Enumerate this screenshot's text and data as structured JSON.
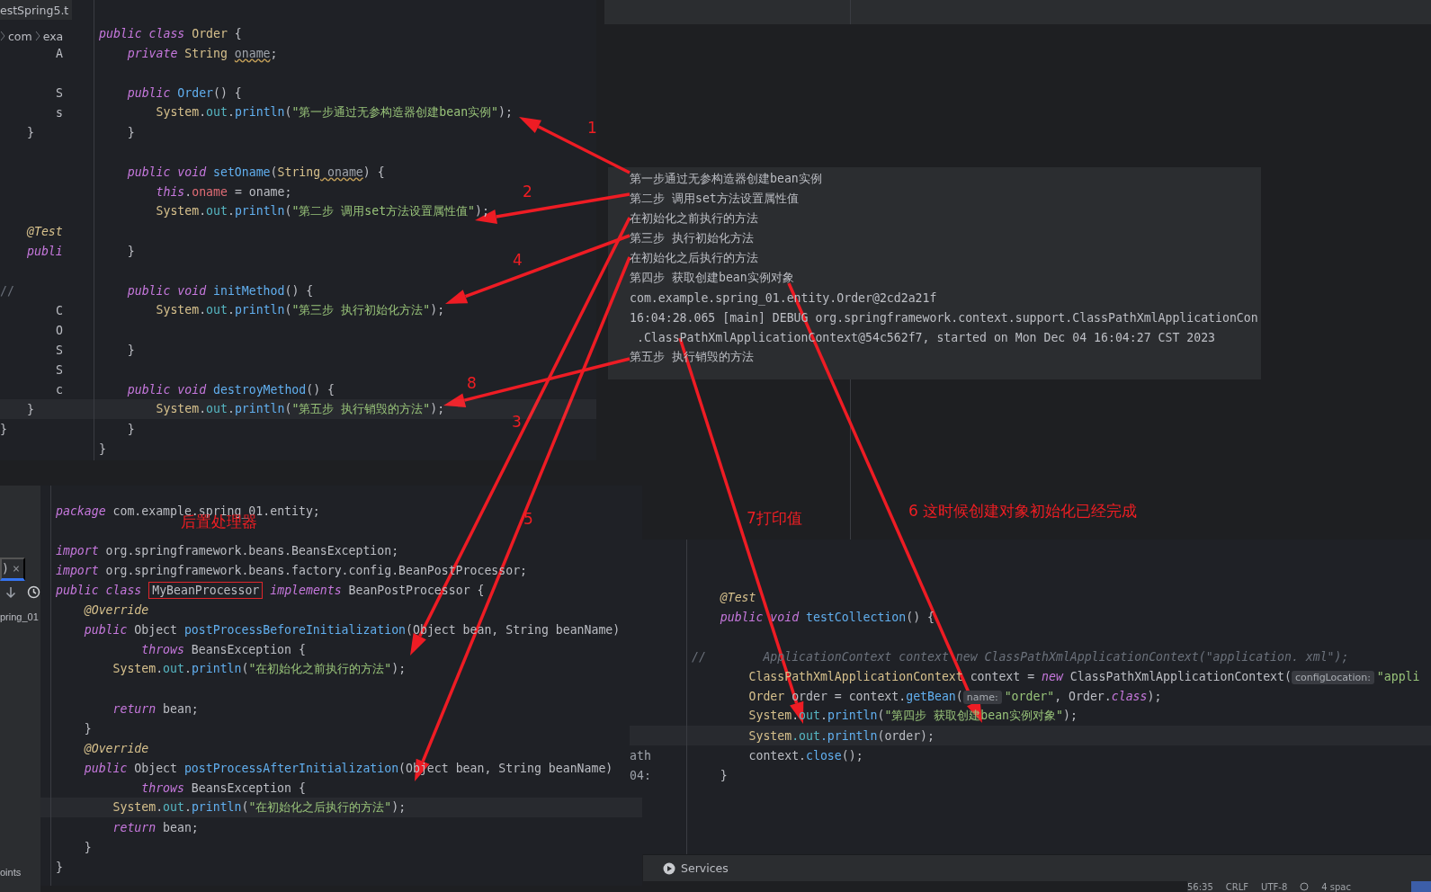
{
  "top_editor": {
    "tab": "estSpring5.t",
    "breadcrumbs": [
      "com",
      "exa"
    ],
    "rows": [
      {
        "kind": "top",
        "tokens": [
          {
            "kind": "kw",
            "text": "public class"
          },
          {
            "kind": "type",
            "text": " Order"
          },
          {
            "kind": "plain",
            "text": " {"
          }
        ]
      },
      {
        "kind": "member",
        "side": {
          "text": "A",
          "kind": "member"
        },
        "tokens": [
          {
            "kind": "kw",
            "text": "private"
          },
          {
            "kind": "type",
            "text": " String "
          },
          {
            "kind": "warn",
            "text": "oname"
          },
          {
            "kind": "plain",
            "text": ";"
          }
        ]
      },
      {
        "kind": "blank"
      },
      {
        "kind": "member",
        "side": {
          "text": "S",
          "kind": "member"
        },
        "tokens": [
          {
            "kind": "kw",
            "text": "public"
          },
          {
            "kind": "fn",
            "text": " Order"
          },
          {
            "kind": "plain",
            "text": "() {"
          }
        ]
      },
      {
        "kind": "statement",
        "side": {
          "text": "s",
          "kind": "member"
        },
        "tokens": [
          {
            "kind": "type",
            "text": "System"
          },
          {
            "kind": "plain",
            "text": "."
          },
          {
            "kind": "field",
            "text": "out"
          },
          {
            "kind": "plain",
            "text": "."
          },
          {
            "kind": "fn",
            "text": "println"
          },
          {
            "kind": "plain",
            "text": "("
          },
          {
            "kind": "str",
            "text": "\"第一步通过无参构造器创建bean实例\""
          },
          {
            "kind": "plain",
            "text": ");"
          }
        ]
      },
      {
        "kind": "member",
        "side": {
          "text": "}",
          "kind": "close-method"
        },
        "tokens": [
          {
            "kind": "plain",
            "text": "}"
          }
        ]
      },
      {
        "kind": "blank"
      },
      {
        "kind": "member",
        "tokens": [
          {
            "kind": "kw",
            "text": "public void"
          },
          {
            "kind": "fn",
            "text": " setOname"
          },
          {
            "kind": "plain",
            "text": "("
          },
          {
            "kind": "type",
            "text": "String"
          },
          {
            "kind": "warn",
            "text": " oname"
          },
          {
            "kind": "plain",
            "text": ") {"
          }
        ]
      },
      {
        "kind": "statement",
        "tokens": [
          {
            "kind": "kw",
            "text": "this"
          },
          {
            "kind": "plain",
            "text": "."
          },
          {
            "kind": "var",
            "text": "oname"
          },
          {
            "kind": "plain",
            "text": " = oname;"
          }
        ]
      },
      {
        "kind": "statement",
        "tokens": [
          {
            "kind": "type",
            "text": "System"
          },
          {
            "kind": "plain",
            "text": "."
          },
          {
            "kind": "field",
            "text": "out"
          },
          {
            "kind": "plain",
            "text": "."
          },
          {
            "kind": "fn",
            "text": "println"
          },
          {
            "kind": "plain",
            "text": "("
          },
          {
            "kind": "str",
            "text": "\"第二步 调用set方法设置属性值\""
          },
          {
            "kind": "plain",
            "text": ");"
          }
        ]
      },
      {
        "kind": "top",
        "side": {
          "text": "@Test",
          "kind": "annotation"
        }
      },
      {
        "kind": "member",
        "side": {
          "text": "publi",
          "kind": "keyword"
        },
        "tokens": [
          {
            "kind": "plain",
            "text": "}"
          }
        ]
      },
      {
        "kind": "blank"
      },
      {
        "kind": "member",
        "side": {
          "text": "//",
          "kind": "comment"
        },
        "tokens": [
          {
            "kind": "kw",
            "text": "public void"
          },
          {
            "kind": "fn",
            "text": " initMethod"
          },
          {
            "kind": "plain",
            "text": "() {"
          }
        ]
      },
      {
        "kind": "statement",
        "side": {
          "text": "C",
          "kind": "member"
        },
        "tokens": [
          {
            "kind": "type",
            "text": "System"
          },
          {
            "kind": "plain",
            "text": "."
          },
          {
            "kind": "field",
            "text": "out"
          },
          {
            "kind": "plain",
            "text": "."
          },
          {
            "kind": "fn",
            "text": "println"
          },
          {
            "kind": "plain",
            "text": "("
          },
          {
            "kind": "str",
            "text": "\"第三步 执行初始化方法\""
          },
          {
            "kind": "plain",
            "text": ");"
          }
        ]
      },
      {
        "kind": "top",
        "side": {
          "text": "O",
          "kind": "member"
        }
      },
      {
        "kind": "member",
        "side": {
          "text": "S",
          "kind": "member"
        },
        "tokens": [
          {
            "kind": "plain",
            "text": "}"
          }
        ]
      },
      {
        "kind": "top",
        "side": {
          "text": "S",
          "kind": "member"
        }
      },
      {
        "kind": "member",
        "side": {
          "text": "c",
          "kind": "member"
        },
        "tokens": [
          {
            "kind": "kw",
            "text": "public void"
          },
          {
            "kind": "fn",
            "text": " destroyMethod"
          },
          {
            "kind": "plain",
            "text": "() {"
          }
        ]
      },
      {
        "kind": "statement",
        "current": true,
        "side": {
          "text": "}",
          "kind": "close-method"
        },
        "tokens": [
          {
            "kind": "type",
            "text": "System"
          },
          {
            "kind": "plain",
            "text": "."
          },
          {
            "kind": "field",
            "text": "out"
          },
          {
            "kind": "plain",
            "text": "."
          },
          {
            "kind": "fn",
            "text": "println"
          },
          {
            "kind": "plain",
            "text": "("
          },
          {
            "kind": "str",
            "text": "\"第五步 执行销毁的方法\""
          },
          {
            "kind": "plain",
            "text": ");"
          }
        ]
      },
      {
        "kind": "member",
        "side": {
          "text": "}",
          "kind": "close-class"
        },
        "tokens": [
          {
            "kind": "plain",
            "text": "}"
          }
        ]
      },
      {
        "kind": "top",
        "tokens": [
          {
            "kind": "plain",
            "text": "}"
          }
        ]
      }
    ]
  },
  "console": {
    "lines": [
      {
        "kind": "top",
        "text": "第一步通过无参构造器创建bean实例"
      },
      {
        "kind": "top",
        "text": "第二步 调用set方法设置属性值"
      },
      {
        "kind": "top",
        "text": "在初始化之前执行的方法"
      },
      {
        "kind": "top",
        "text": "第三步 执行初始化方法"
      },
      {
        "kind": "top",
        "text": "在初始化之后执行的方法"
      },
      {
        "kind": "top",
        "text": "第四步 获取创建bean实例对象"
      },
      {
        "kind": "top",
        "text": "com.example.spring_01.entity.Order@2cd2a21f"
      },
      {
        "kind": "top",
        "text": "16:04:28.065 [main] DEBUG org.springframework.context.support.ClassPathXmlApplicationCon"
      },
      {
        "kind": "wrapped",
        "text": ".ClassPathXmlApplicationContext@54c562f7, started on Mon Dec 04 16:04:27 CST 2023"
      },
      {
        "kind": "top",
        "text": "第五步 执行销毁的方法"
      }
    ]
  },
  "processor_editor": {
    "left_panel": {
      "tab": {
        "label": ")",
        "close": "×",
        "selected": true
      },
      "project_item": "pring_01",
      "bottom_item": "oints"
    },
    "rows": [
      {
        "kind": "top",
        "tokens": [
          {
            "kind": "kw",
            "text": "package"
          },
          {
            "kind": "plain",
            "text": " com.example.spring_01.entity;"
          }
        ]
      },
      {
        "kind": "blank"
      },
      {
        "kind": "top",
        "tokens": [
          {
            "kind": "kw",
            "text": "import"
          },
          {
            "kind": "plain",
            "text": " org.springframework.beans.BeansException;"
          }
        ]
      },
      {
        "kind": "top",
        "tokens": [
          {
            "kind": "kw",
            "text": "import"
          },
          {
            "kind": "plain",
            "text": " org.springframework.beans.factory.config.BeanPostProcessor;"
          }
        ]
      },
      {
        "kind": "top",
        "tokens": [
          {
            "kind": "kw",
            "text": "public class "
          },
          {
            "kind": "boxed",
            "text": "MyBeanProcessor"
          },
          {
            "kind": "kw",
            "text": " implements"
          },
          {
            "kind": "plain",
            "text": " BeanPostProcessor {"
          }
        ]
      },
      {
        "kind": "member",
        "tokens": [
          {
            "kind": "ann",
            "text": "@Override"
          }
        ]
      },
      {
        "kind": "member",
        "tokens": [
          {
            "kind": "kw",
            "text": "public"
          },
          {
            "kind": "plain",
            "text": " Object "
          },
          {
            "kind": "fn",
            "text": "postProcessBeforeInitialization"
          },
          {
            "kind": "plain",
            "text": "(Object bean, String beanName)"
          }
        ]
      },
      {
        "kind": "continuation",
        "tokens": [
          {
            "kind": "kw",
            "text": "throws"
          },
          {
            "kind": "plain",
            "text": " BeansException {"
          }
        ]
      },
      {
        "kind": "statement",
        "tokens": [
          {
            "kind": "type",
            "text": "System"
          },
          {
            "kind": "plain",
            "text": "."
          },
          {
            "kind": "field",
            "text": "out"
          },
          {
            "kind": "plain",
            "text": "."
          },
          {
            "kind": "fn",
            "text": "println"
          },
          {
            "kind": "plain",
            "text": "("
          },
          {
            "kind": "str",
            "text": "\"在初始化之前执行的方法\""
          },
          {
            "kind": "plain",
            "text": ");"
          }
        ]
      },
      {
        "kind": "blank"
      },
      {
        "kind": "statement",
        "tokens": [
          {
            "kind": "kw",
            "text": "return"
          },
          {
            "kind": "plain",
            "text": " bean;"
          }
        ]
      },
      {
        "kind": "member",
        "tokens": [
          {
            "kind": "plain",
            "text": "}"
          }
        ]
      },
      {
        "kind": "member",
        "tokens": [
          {
            "kind": "ann",
            "text": "@Override"
          }
        ]
      },
      {
        "kind": "member",
        "tokens": [
          {
            "kind": "kw",
            "text": "public"
          },
          {
            "kind": "plain",
            "text": " Object "
          },
          {
            "kind": "fn",
            "text": "postProcessAfterInitialization"
          },
          {
            "kind": "plain",
            "text": "(Object bean, String beanName)"
          }
        ]
      },
      {
        "kind": "continuation",
        "tokens": [
          {
            "kind": "kw",
            "text": "throws"
          },
          {
            "kind": "plain",
            "text": " BeansException {"
          }
        ]
      },
      {
        "kind": "statement",
        "current": true,
        "tokens": [
          {
            "kind": "type",
            "text": "System"
          },
          {
            "kind": "plain",
            "text": "."
          },
          {
            "kind": "field",
            "text": "out"
          },
          {
            "kind": "plain",
            "text": "."
          },
          {
            "kind": "fn",
            "text": "println"
          },
          {
            "kind": "plain",
            "text": "("
          },
          {
            "kind": "str",
            "text": "\"在初始化之后执行的方法\""
          },
          {
            "kind": "plain",
            "text": ");"
          }
        ]
      },
      {
        "kind": "statement",
        "tokens": [
          {
            "kind": "kw",
            "text": "return"
          },
          {
            "kind": "plain",
            "text": " bean;"
          }
        ]
      },
      {
        "kind": "member",
        "tokens": [
          {
            "kind": "plain",
            "text": "}"
          }
        ]
      },
      {
        "kind": "top",
        "tokens": [
          {
            "kind": "plain",
            "text": "}"
          }
        ]
      }
    ]
  },
  "test_editor": {
    "rows": [
      {
        "kind": "member",
        "tokens": [
          {
            "kind": "ann",
            "text": "@Test"
          }
        ]
      },
      {
        "kind": "member",
        "tokens": [
          {
            "kind": "kw",
            "text": "public void"
          },
          {
            "kind": "fn",
            "text": " testCollection"
          },
          {
            "kind": "plain",
            "text": "() {"
          }
        ]
      },
      {
        "kind": "blank"
      },
      {
        "kind": "top",
        "tokens": [
          {
            "kind": "cmt",
            "text": "//        ApplicationContext context new ClassPathXmlApplicationContext(\"application. xml\");"
          }
        ]
      },
      {
        "kind": "statement",
        "tokens": [
          {
            "kind": "type",
            "text": "ClassPathXmlApplicationContext"
          },
          {
            "kind": "plain",
            "text": " context = "
          },
          {
            "kind": "kw",
            "text": "new"
          },
          {
            "kind": "plain",
            "text": " ClassPathXmlApplicationContext("
          },
          {
            "kind": "hint",
            "text": "configLocation:"
          },
          {
            "kind": "str",
            "text": "\"appli"
          }
        ]
      },
      {
        "kind": "statement",
        "tokens": [
          {
            "kind": "type",
            "text": "Order"
          },
          {
            "kind": "plain",
            "text": " order = context."
          },
          {
            "kind": "fn",
            "text": "getBean"
          },
          {
            "kind": "plain",
            "text": "("
          },
          {
            "kind": "hint",
            "text": "name:"
          },
          {
            "kind": "str",
            "text": "\"order\""
          },
          {
            "kind": "plain",
            "text": ", Order."
          },
          {
            "kind": "kw",
            "text": "class"
          },
          {
            "kind": "plain",
            "text": ");"
          }
        ]
      },
      {
        "kind": "statement",
        "tokens": [
          {
            "kind": "type",
            "text": "System"
          },
          {
            "kind": "plain",
            "text": "."
          },
          {
            "kind": "field",
            "text": "out"
          },
          {
            "kind": "plain",
            "text": "."
          },
          {
            "kind": "fn",
            "text": "println"
          },
          {
            "kind": "plain",
            "text": "("
          },
          {
            "kind": "str",
            "text": "\"第四步 获取创建bean实例对象\""
          },
          {
            "kind": "plain",
            "text": ");"
          }
        ]
      },
      {
        "kind": "statement",
        "current": true,
        "tokens": [
          {
            "kind": "type",
            "text": "System"
          },
          {
            "kind": "field",
            "text": ".out"
          },
          {
            "kind": "fn",
            "text": ".println"
          },
          {
            "kind": "plain",
            "text": "(order);"
          }
        ]
      },
      {
        "kind": "statement",
        "side": {
          "text": "ath",
          "kind": "fragment"
        },
        "tokens": [
          {
            "kind": "plain",
            "text": "context."
          },
          {
            "kind": "fn",
            "text": "close"
          },
          {
            "kind": "plain",
            "text": "();"
          }
        ]
      },
      {
        "kind": "member",
        "side": {
          "text": "04:",
          "kind": "fragment"
        },
        "tokens": [
          {
            "kind": "plain",
            "text": "}"
          }
        ]
      }
    ]
  },
  "tool_bar": {
    "services": "Services"
  },
  "status_bar": {
    "items": [
      "56:35",
      "CRLF",
      "UTF-8",
      "4 spac"
    ]
  },
  "annotations": [
    {
      "text": "1"
    },
    {
      "text": "2"
    },
    {
      "text": "4"
    },
    {
      "text": "8"
    },
    {
      "text": "3"
    },
    {
      "text": "后置处理器"
    },
    {
      "text": "5"
    },
    {
      "text": "7打印值"
    },
    {
      "text": "6 这时候创建对象初始化已经完成"
    }
  ]
}
